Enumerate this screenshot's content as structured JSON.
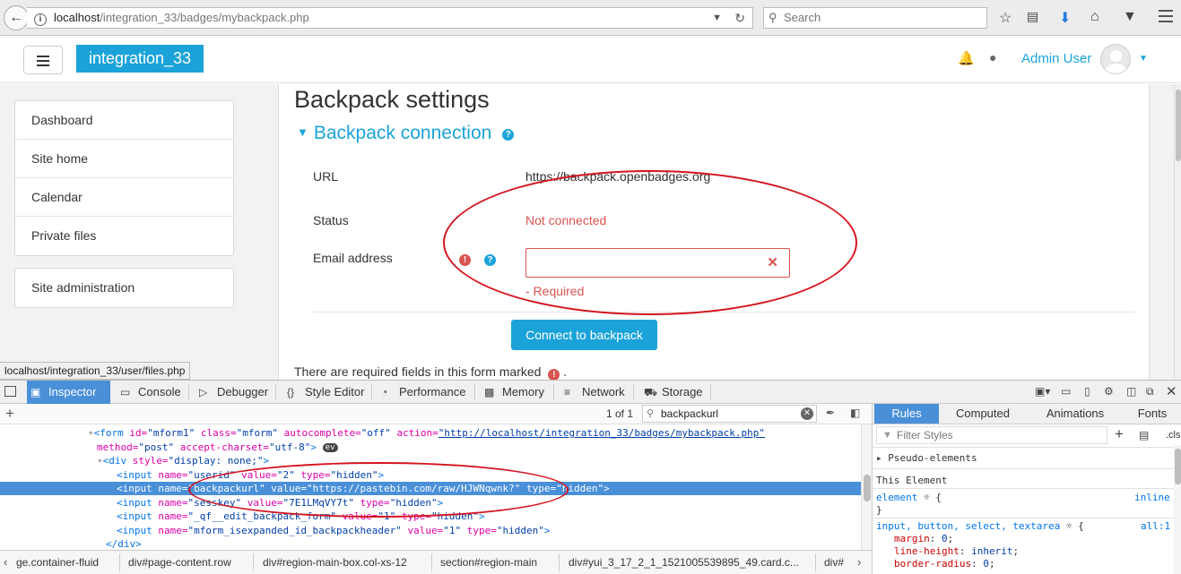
{
  "browser": {
    "url_host": "localhost",
    "url_path": "/integration_33/badges/mybackpack.php",
    "search_placeholder": "Search"
  },
  "navbar": {
    "brand": "integration_33",
    "user_name": "Admin User"
  },
  "sidebar": {
    "items": [
      "Dashboard",
      "Site home",
      "Calendar",
      "Private files"
    ],
    "admin_item": "Site administration"
  },
  "main": {
    "title": "Backpack settings",
    "section_title": "Backpack connection",
    "url_label": "URL",
    "url_value": "https://backpack.openbadges.org",
    "status_label": "Status",
    "status_value": "Not connected",
    "email_label": "Email address",
    "email_value": "",
    "required_error": "- Required",
    "connect_button": "Connect to backpack",
    "required_note": "There are required fields in this form marked",
    "required_note_end": "."
  },
  "status_tip": "localhost/integration_33/user/files.php",
  "devtools": {
    "tabs": [
      "Inspector",
      "Console",
      "Debugger",
      "Style Editor",
      "Performance",
      "Memory",
      "Network",
      "Storage"
    ],
    "search_count": "1 of 1",
    "search_value": "backpackurl",
    "code_lines": [
      {
        "indent": 1,
        "parts": [
          [
            "tg",
            "<form "
          ],
          [
            "an",
            "id="
          ],
          [
            "av",
            "\"mform1\" "
          ],
          [
            "an",
            "class="
          ],
          [
            "av",
            "\"mform\" "
          ],
          [
            "an",
            "autocomplete="
          ],
          [
            "av",
            "\"off\" "
          ],
          [
            "an",
            "action="
          ],
          [
            "lk",
            "\"http://localhost/integration_33/badges/mybackpack.php\""
          ]
        ]
      },
      {
        "indent": 1,
        "parts": [
          [
            "an",
            "method="
          ],
          [
            "av",
            "\"post\" "
          ],
          [
            "an",
            "accept-charset="
          ],
          [
            "av",
            "\"utf-8\""
          ],
          [
            "tg",
            ">"
          ]
        ]
      },
      {
        "indent": 2,
        "parts": [
          [
            "tg",
            "<div "
          ],
          [
            "an",
            "style="
          ],
          [
            "av",
            "\"display: none;\""
          ],
          [
            "tg",
            ">"
          ]
        ]
      },
      {
        "indent": 3,
        "parts": [
          [
            "tg",
            "<input "
          ],
          [
            "an",
            "name="
          ],
          [
            "av",
            "\"userid\" "
          ],
          [
            "an",
            "value="
          ],
          [
            "av",
            "\"2\" "
          ],
          [
            "an",
            "type="
          ],
          [
            "av",
            "\"hidden\""
          ],
          [
            "tg",
            ">"
          ]
        ]
      },
      {
        "indent": 3,
        "parts": [
          [
            "tg",
            "<input "
          ],
          [
            "an",
            "name="
          ],
          [
            "av",
            "\"backpackurl\" "
          ],
          [
            "an",
            "value="
          ],
          [
            "av",
            "\"https://pastebin.com/raw/HJWNqwnk?\" "
          ],
          [
            "an",
            "type="
          ],
          [
            "av",
            "\"hidden\""
          ],
          [
            "tg",
            ">"
          ]
        ]
      },
      {
        "indent": 3,
        "parts": [
          [
            "tg",
            "<input "
          ],
          [
            "an",
            "name="
          ],
          [
            "av",
            "\"sesskey\" "
          ],
          [
            "an",
            "value="
          ],
          [
            "av",
            "\"7E1LMqVY7t\" "
          ],
          [
            "an",
            "type="
          ],
          [
            "av",
            "\"hidden\""
          ],
          [
            "tg",
            ">"
          ]
        ]
      },
      {
        "indent": 3,
        "parts": [
          [
            "tg",
            "<input "
          ],
          [
            "an",
            "name="
          ],
          [
            "av",
            "\"_qf__edit_backpack_form\" "
          ],
          [
            "an",
            "value="
          ],
          [
            "av",
            "\"1\" "
          ],
          [
            "an",
            "type="
          ],
          [
            "av",
            "\"hidden\""
          ],
          [
            "tg",
            ">"
          ]
        ]
      },
      {
        "indent": 3,
        "parts": [
          [
            "tg",
            "<input "
          ],
          [
            "an",
            "name="
          ],
          [
            "av",
            "\"mform_isexpanded_id_backpackheader\" "
          ],
          [
            "an",
            "value="
          ],
          [
            "av",
            "\"1\" "
          ],
          [
            "an",
            "type="
          ],
          [
            "av",
            "\"hidden\""
          ],
          [
            "tg",
            ">"
          ]
        ]
      },
      {
        "indent": 2,
        "parts": [
          [
            "tg",
            "</div>"
          ]
        ]
      }
    ],
    "event_badge": "ev",
    "breadcrumbs": [
      "ge.container-fluid",
      "div#page-content.row",
      "div#region-main-box.col-xs-12",
      "section#region-main",
      "div#yui_3_17_2_1_1521005539895_49.card.c...",
      "div#"
    ],
    "rules_tabs": [
      "Rules",
      "Computed",
      "Animations",
      "Fonts"
    ],
    "filter_placeholder": "Filter Styles",
    "cls_label": ".cls",
    "pseudo_elements": "Pseudo-elements",
    "this_element": "This Element",
    "element_rule": "element",
    "inline_label": "inline",
    "rule_selector": "input, button, select, textarea",
    "rule_source": "all:1",
    "rule_props": [
      {
        "name": "margin",
        "value": "0"
      },
      {
        "name": "line-height",
        "value": "inherit"
      },
      {
        "name": "border-radius",
        "value": "0"
      }
    ]
  },
  "colors": {
    "accent": "#1ba3d9",
    "error": "#d9534f",
    "annotation": "#d4141f",
    "devtools_selected": "#4a90d9"
  }
}
